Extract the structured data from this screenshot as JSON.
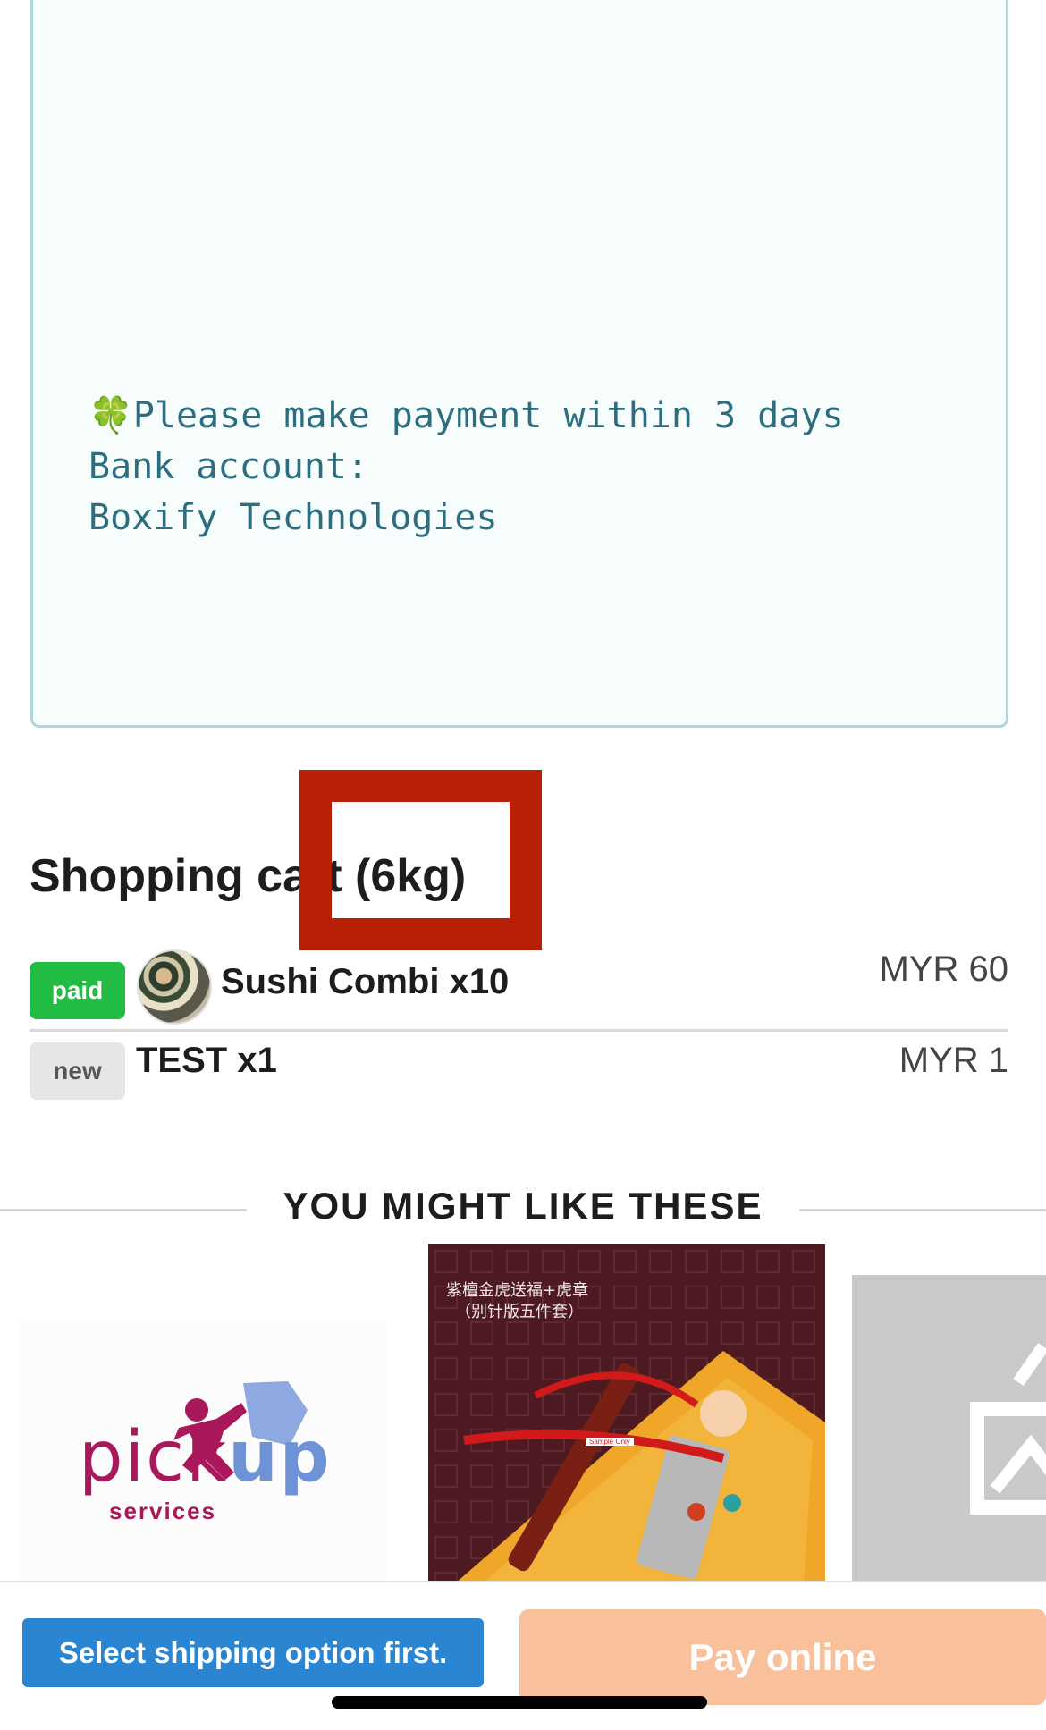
{
  "note": {
    "line1_icon": "🍀",
    "line1": "Please make payment within 3 days",
    "line2": "Bank account:",
    "line3": "Boxify Technologies"
  },
  "cart": {
    "title": "Shopping cart (6kg)",
    "items": [
      {
        "status": "paid",
        "name": "Sushi Combi x10",
        "price": "MYR 60",
        "status_color": "#22bb44"
      },
      {
        "status": "new",
        "name": "TEST x1",
        "price": "MYR 1",
        "status_color": "#e6e6e6"
      }
    ]
  },
  "suggestions": {
    "title": "YOU MIGHT LIKE THESE",
    "cards": [
      {
        "logo_pick": "pick",
        "logo_up": "up",
        "logo_services": "services"
      },
      {
        "caption_line1": "紫檀金虎送福+虎章",
        "caption_line2": "（别针版五件套）",
        "sample_label": "Sample Only"
      },
      {
        "icon": "image-placeholder-icon"
      }
    ]
  },
  "actions": {
    "shipping_label": "Select shipping option first.",
    "pay_label": "Pay online",
    "shipping_color": "#2a86d2",
    "pay_color": "#f8c19c"
  }
}
